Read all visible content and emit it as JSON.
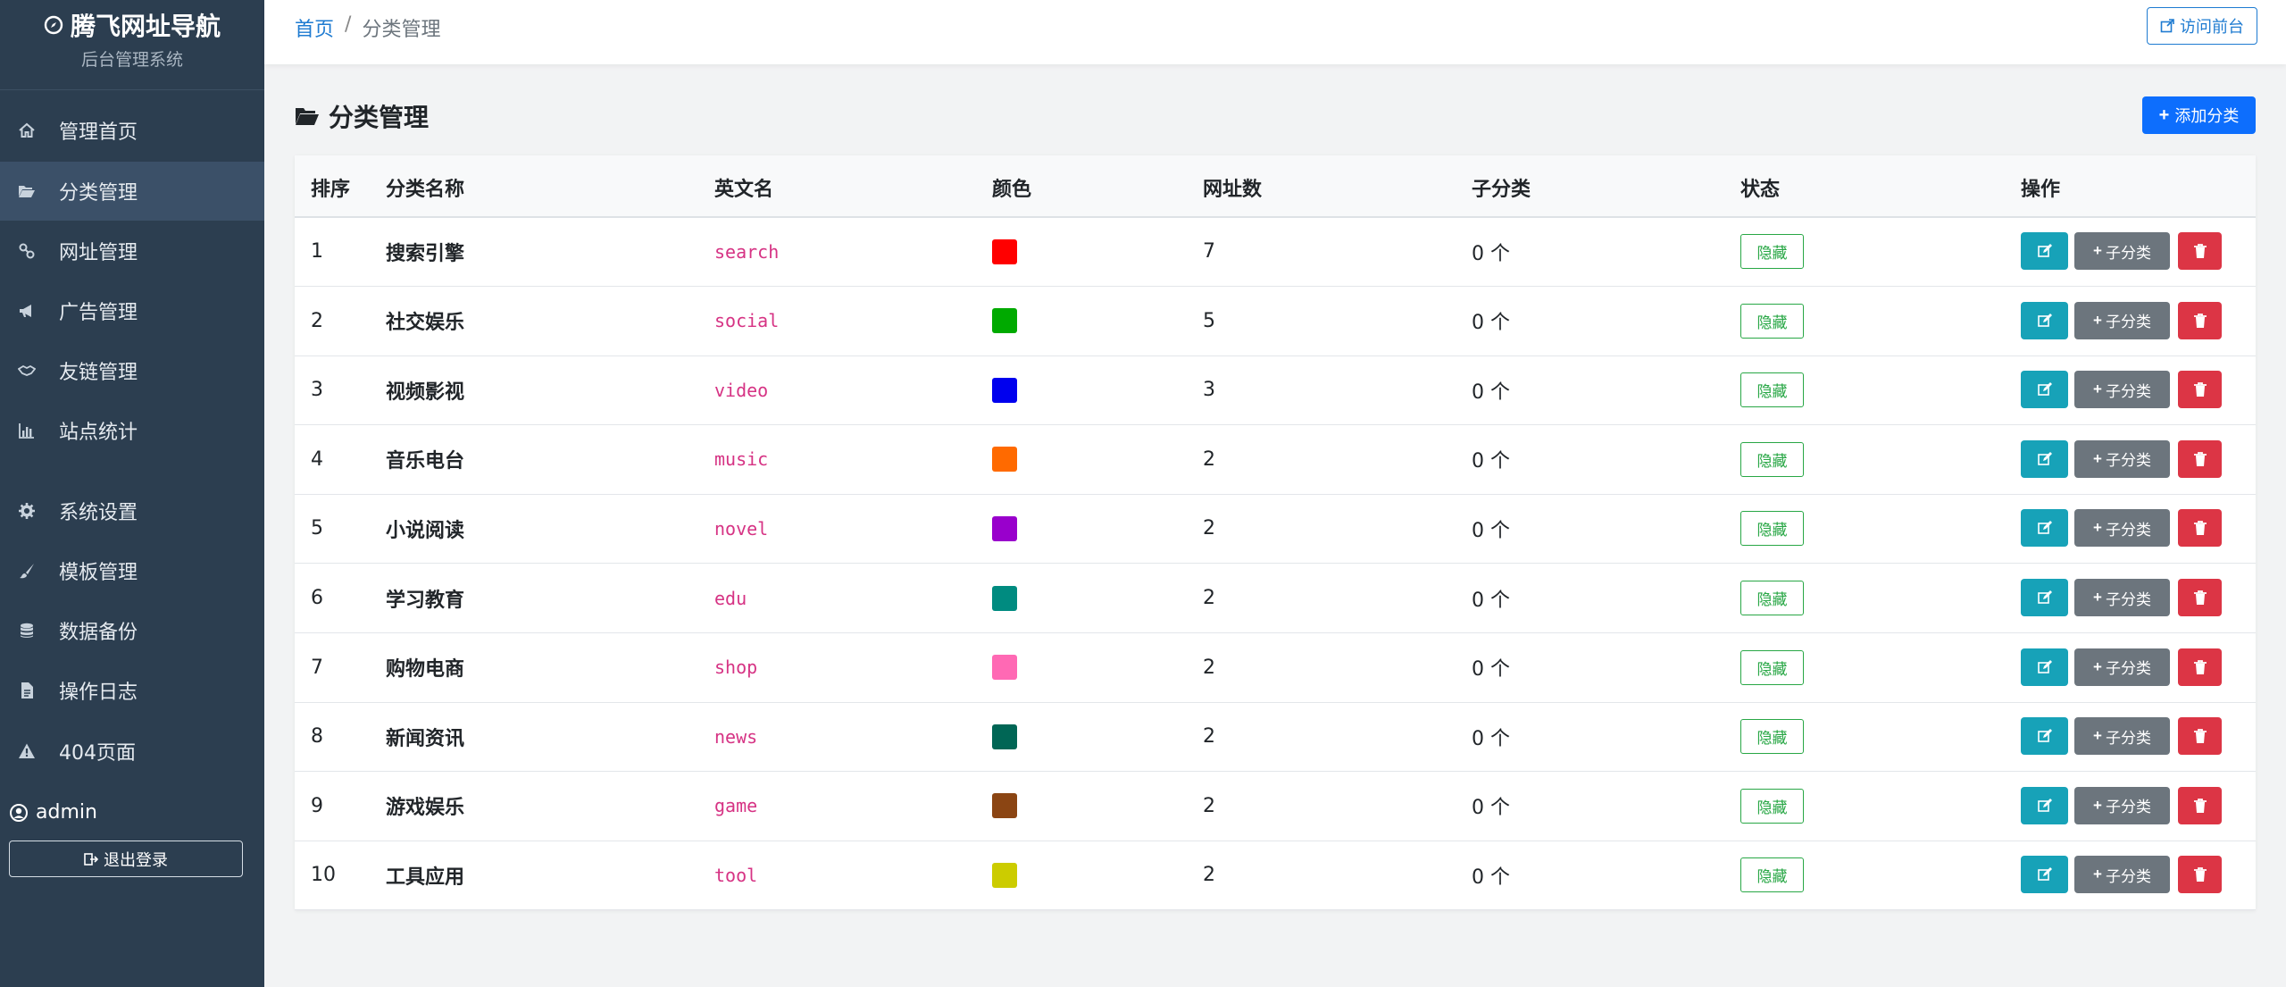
{
  "sidebar": {
    "brand_title": "腾飞网址导航",
    "brand_subtitle": "后台管理系统",
    "items": [
      {
        "label": "管理首页",
        "icon": "home-icon",
        "active": false
      },
      {
        "label": "分类管理",
        "icon": "folder-open-icon",
        "active": true
      },
      {
        "label": "网址管理",
        "icon": "link-icon",
        "active": false
      },
      {
        "label": "广告管理",
        "icon": "bullhorn-icon",
        "active": false
      },
      {
        "label": "友链管理",
        "icon": "handshake-icon",
        "active": false
      },
      {
        "label": "站点统计",
        "icon": "bar-chart-icon",
        "active": false
      },
      {
        "label": "系统设置",
        "icon": "gear-icon",
        "active": false
      },
      {
        "label": "模板管理",
        "icon": "brush-icon",
        "active": false
      },
      {
        "label": "数据备份",
        "icon": "database-icon",
        "active": false
      },
      {
        "label": "操作日志",
        "icon": "file-icon",
        "active": false
      },
      {
        "label": "404页面",
        "icon": "warning-icon",
        "active": false
      }
    ],
    "username": "admin",
    "logout_label": "退出登录"
  },
  "header": {
    "breadcrumb_home": "首页",
    "breadcrumb_sep": "/",
    "breadcrumb_current": "分类管理",
    "visit_label": "访问前台"
  },
  "main": {
    "title": "分类管理",
    "add_label": "添加分类",
    "columns": [
      "排序",
      "分类名称",
      "英文名",
      "颜色",
      "网址数",
      "子分类",
      "状态",
      "操作"
    ],
    "rows": [
      {
        "order": "1",
        "name": "搜索引擎",
        "en": "search",
        "color": "#ff0000",
        "count": "7",
        "sub": "0 个",
        "status": "隐藏"
      },
      {
        "order": "2",
        "name": "社交娱乐",
        "en": "social",
        "color": "#00aa00",
        "count": "5",
        "sub": "0 个",
        "status": "隐藏"
      },
      {
        "order": "3",
        "name": "视频影视",
        "en": "video",
        "color": "#0000ee",
        "count": "3",
        "sub": "0 个",
        "status": "隐藏"
      },
      {
        "order": "4",
        "name": "音乐电台",
        "en": "music",
        "color": "#ff6a00",
        "count": "2",
        "sub": "0 个",
        "status": "隐藏"
      },
      {
        "order": "5",
        "name": "小说阅读",
        "en": "novel",
        "color": "#9900cc",
        "count": "2",
        "sub": "0 个",
        "status": "隐藏"
      },
      {
        "order": "6",
        "name": "学习教育",
        "en": "edu",
        "color": "#008b80",
        "count": "2",
        "sub": "0 个",
        "status": "隐藏"
      },
      {
        "order": "7",
        "name": "购物电商",
        "en": "shop",
        "color": "#ff69b4",
        "count": "2",
        "sub": "0 个",
        "status": "隐藏"
      },
      {
        "order": "8",
        "name": "新闻资讯",
        "en": "news",
        "color": "#006655",
        "count": "2",
        "sub": "0 个",
        "status": "隐藏"
      },
      {
        "order": "9",
        "name": "游戏娱乐",
        "en": "game",
        "color": "#8b4513",
        "count": "2",
        "sub": "0 个",
        "status": "隐藏"
      },
      {
        "order": "10",
        "name": "工具应用",
        "en": "tool",
        "color": "#cccc00",
        "count": "2",
        "sub": "0 个",
        "status": "隐藏"
      }
    ],
    "sub_button_label": "子分类",
    "colors": {
      "edit": "#17a2b8",
      "sub": "#6c757d",
      "delete": "#dc3545",
      "primary": "#0d6efd",
      "status": "#28a745"
    }
  }
}
